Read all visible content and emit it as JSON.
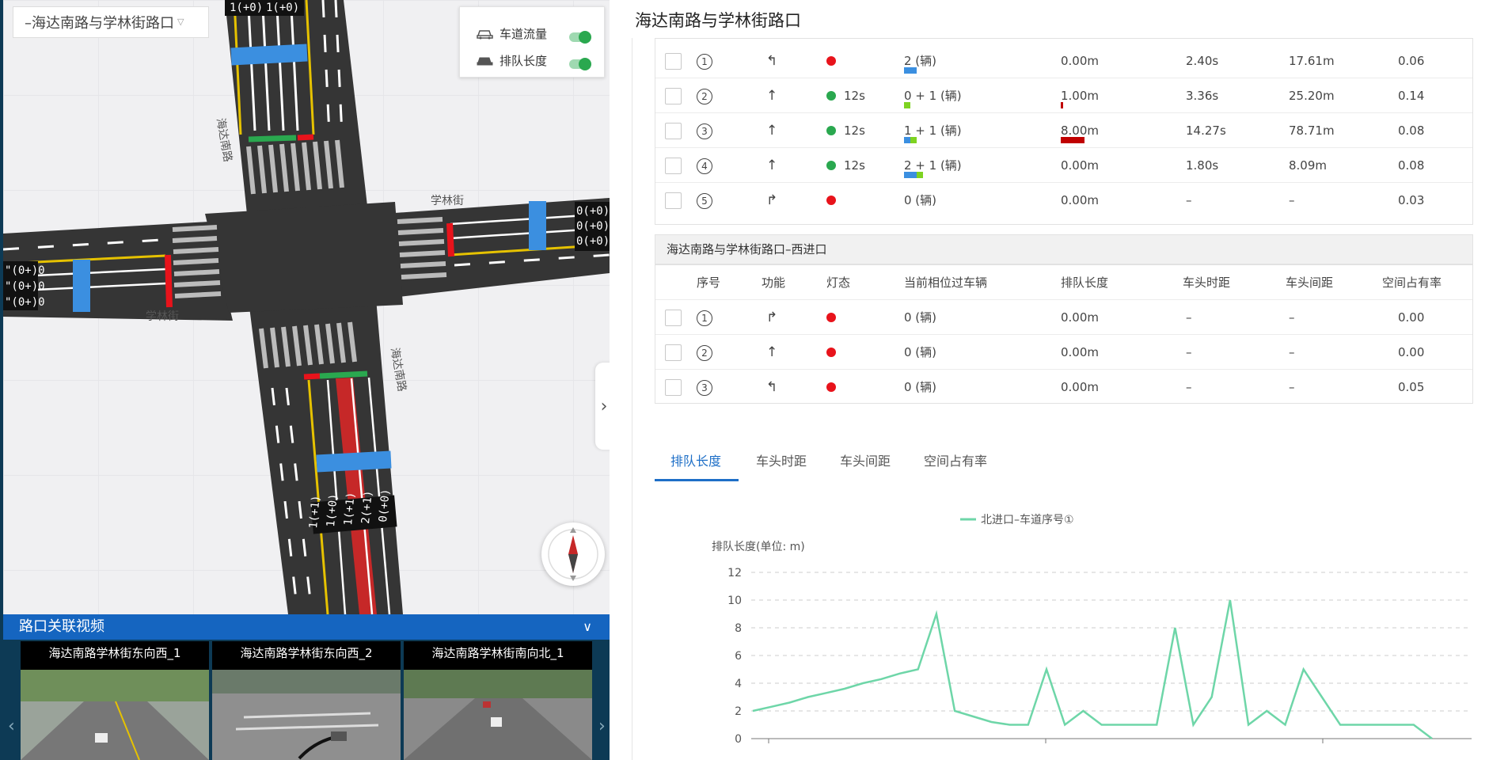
{
  "intersection_select": {
    "value": "–海达南路与学林街路口",
    "chevron_icon": "chevron-down-icon"
  },
  "toggles": [
    {
      "label": "车道流量",
      "on": true,
      "icon": "car-flow-icon"
    },
    {
      "label": "排队长度",
      "on": true,
      "icon": "car-queue-icon"
    }
  ],
  "map": {
    "road_labels": {
      "north": "海达南路",
      "east": "学林街",
      "west": "学林街",
      "south": "海达南路"
    },
    "east_counts": [
      "0(+0)",
      "0(+0)",
      "0(+0)"
    ],
    "west_counts": [
      "\"(0+)0",
      "\"(0+)0",
      "\"(0+)0"
    ],
    "north_counts": [
      "1(+0)",
      "1(+0)"
    ],
    "south_counts": [
      "1(+1)",
      "1(+0)",
      "1(+1)",
      "2(+1)",
      "0(+0)"
    ],
    "compass_icon": "compass-icon",
    "collapse_icon": "chevron-right-icon"
  },
  "video_panel": {
    "title": "路口关联视频",
    "chevron_icon": "chevron-down-icon",
    "videos": [
      {
        "title": "海达南路学林街东向西_1"
      },
      {
        "title": "海达南路学林街东向西_2"
      },
      {
        "title": "海达南路学林街南向北_1"
      }
    ]
  },
  "right_title": "海达南路与学林街路口",
  "north_table": {
    "rows": [
      {
        "no": "1",
        "func_icon": "turn-left-arrow-icon",
        "light": "red",
        "light_text": "",
        "vehicles": "2 (辆)",
        "queue": "0.00m",
        "headway_time": "2.40s",
        "headway_dist": "17.61m",
        "occupancy": "0.06",
        "bars_vehicles": [
          {
            "color": "#3b8fe0",
            "w": 16
          }
        ],
        "bars_queue": []
      },
      {
        "no": "2",
        "func_icon": "straight-arrow-icon",
        "light": "green",
        "light_text": "12s",
        "vehicles": "0 + 1 (辆)",
        "queue": "1.00m",
        "headway_time": "3.36s",
        "headway_dist": "25.20m",
        "occupancy": "0.14",
        "bars_vehicles": [
          {
            "color": "#7ed321",
            "w": 8
          }
        ],
        "bars_queue": [
          {
            "color": "#c00000",
            "w": 3
          }
        ]
      },
      {
        "no": "3",
        "func_icon": "straight-arrow-icon",
        "light": "green",
        "light_text": "12s",
        "vehicles": "1 + 1 (辆)",
        "queue": "8.00m",
        "headway_time": "14.27s",
        "headway_dist": "78.71m",
        "occupancy": "0.08",
        "bars_vehicles": [
          {
            "color": "#3b8fe0",
            "w": 8
          },
          {
            "color": "#7ed321",
            "w": 8
          }
        ],
        "bars_queue": [
          {
            "color": "#c00000",
            "w": 30
          }
        ]
      },
      {
        "no": "4",
        "func_icon": "straight-arrow-icon",
        "light": "green",
        "light_text": "12s",
        "vehicles": "2 + 1 (辆)",
        "queue": "0.00m",
        "headway_time": "1.80s",
        "headway_dist": "8.09m",
        "occupancy": "0.08",
        "bars_vehicles": [
          {
            "color": "#3b8fe0",
            "w": 16
          },
          {
            "color": "#7ed321",
            "w": 8
          }
        ],
        "bars_queue": []
      },
      {
        "no": "5",
        "func_icon": "turn-right-arrow-icon",
        "light": "red",
        "light_text": "",
        "vehicles": "0 (辆)",
        "queue": "0.00m",
        "headway_time": "–",
        "headway_dist": "–",
        "occupancy": "0.03",
        "bars_vehicles": [],
        "bars_queue": []
      }
    ]
  },
  "west_group": {
    "title": "海达南路与学林街路口–西进口",
    "headers": {
      "no": "序号",
      "func": "功能",
      "light": "灯态",
      "vehicles": "当前相位过车辆",
      "queue": "排队长度",
      "headway_time": "车头时距",
      "headway_dist": "车头间距",
      "occupancy": "空间占有率"
    },
    "rows": [
      {
        "no": "1",
        "func_icon": "turn-right-arrow-icon",
        "light": "red",
        "light_text": "",
        "vehicles": "0 (辆)",
        "queue": "0.00m",
        "headway_time": "–",
        "headway_dist": "–",
        "occupancy": "0.00",
        "bars_vehicles": [],
        "bars_queue": []
      },
      {
        "no": "2",
        "func_icon": "straight-arrow-icon",
        "light": "red",
        "light_text": "",
        "vehicles": "0 (辆)",
        "queue": "0.00m",
        "headway_time": "–",
        "headway_dist": "–",
        "occupancy": "0.00",
        "bars_vehicles": [],
        "bars_queue": []
      },
      {
        "no": "3",
        "func_icon": "turn-left-arrow-icon",
        "light": "red",
        "light_text": "",
        "vehicles": "0 (辆)",
        "queue": "0.00m",
        "headway_time": "–",
        "headway_dist": "–",
        "occupancy": "0.05",
        "bars_vehicles": [],
        "bars_queue": []
      }
    ]
  },
  "chart_tabs": [
    {
      "label": "排队长度",
      "active": true
    },
    {
      "label": "车头时距",
      "active": false
    },
    {
      "label": "车头间距",
      "active": false
    },
    {
      "label": "空间占有率",
      "active": false
    }
  ],
  "colors": {
    "accent": "#1e6fc7",
    "red_light": "#e8131b",
    "green_light": "#2aa84f",
    "line": "#6ed6a8",
    "video_bar": "#1565c0"
  },
  "chart_data": {
    "type": "line",
    "ylabel": "排队长度(单位: m)",
    "legend": "北进口–车道序号①",
    "legend_position": "top-center",
    "ylim": [
      0,
      12
    ],
    "yticks": [
      0,
      2,
      4,
      6,
      8,
      10,
      12
    ],
    "grid": true,
    "series": [
      {
        "name": "北进口–车道序号①",
        "values": [
          2,
          2.3,
          2.6,
          3.0,
          3.3,
          3.6,
          4.0,
          4.3,
          4.7,
          5,
          9,
          2,
          1.6,
          1.2,
          1,
          1,
          5,
          1,
          2,
          1,
          1,
          1,
          1,
          8,
          1,
          3,
          10,
          1,
          2,
          1,
          5,
          3,
          1,
          1,
          1,
          1,
          1,
          0
        ]
      }
    ]
  }
}
